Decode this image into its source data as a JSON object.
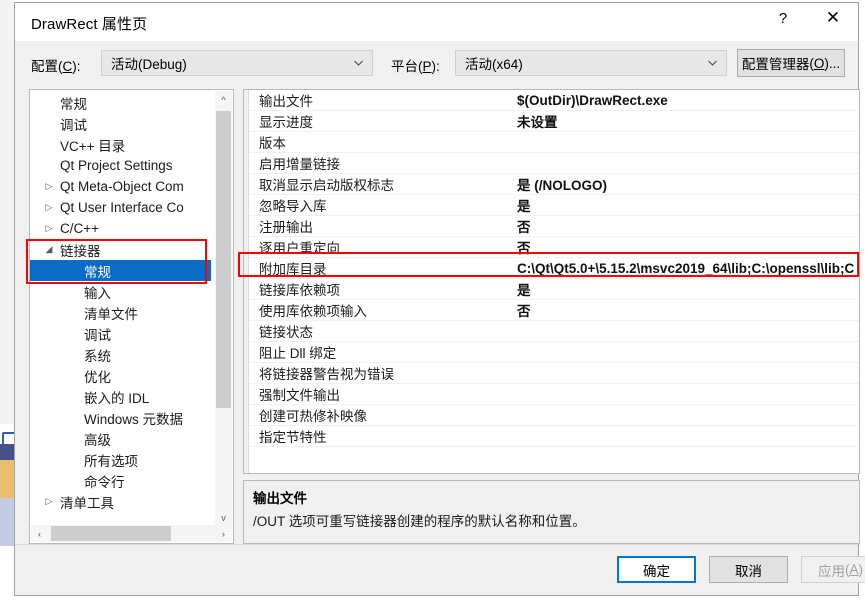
{
  "window": {
    "title": "DrawRect 属性页",
    "help_button": "?",
    "close_button": "✕"
  },
  "config_bar": {
    "config_label": "配置(C):",
    "config_label_plain": "配置",
    "config_label_key": "C",
    "config_value": "活动(Debug)",
    "platform_label": "平台(P):",
    "platform_label_plain": "平台",
    "platform_label_key": "P",
    "platform_value": "活动(x64)",
    "config_manager_button": "配置管理器(O)...",
    "config_manager_plain": "配置管理器",
    "config_manager_key": "O",
    "config_manager_suffix": "..."
  },
  "tree": {
    "items": [
      {
        "label": "常规",
        "indent": 0,
        "arrow": "",
        "selected": false
      },
      {
        "label": "调试",
        "indent": 0,
        "arrow": "",
        "selected": false
      },
      {
        "label": "VC++ 目录",
        "indent": 0,
        "arrow": "",
        "selected": false
      },
      {
        "label": "Qt Project Settings",
        "indent": 0,
        "arrow": "",
        "selected": false
      },
      {
        "label": "Qt Meta-Object Com",
        "indent": 0,
        "arrow": "▷",
        "selected": false
      },
      {
        "label": "Qt User Interface Co",
        "indent": 0,
        "arrow": "▷",
        "selected": false
      },
      {
        "label": "C/C++",
        "indent": 0,
        "arrow": "▷",
        "selected": false
      },
      {
        "label": "链接器",
        "indent": 0,
        "arrow": "◢",
        "selected": false
      },
      {
        "label": "常规",
        "indent": 1,
        "arrow": "",
        "selected": true
      },
      {
        "label": "输入",
        "indent": 1,
        "arrow": "",
        "selected": false
      },
      {
        "label": "清单文件",
        "indent": 1,
        "arrow": "",
        "selected": false
      },
      {
        "label": "调试",
        "indent": 1,
        "arrow": "",
        "selected": false
      },
      {
        "label": "系统",
        "indent": 1,
        "arrow": "",
        "selected": false
      },
      {
        "label": "优化",
        "indent": 1,
        "arrow": "",
        "selected": false
      },
      {
        "label": "嵌入的 IDL",
        "indent": 1,
        "arrow": "",
        "selected": false
      },
      {
        "label": "Windows 元数据",
        "indent": 1,
        "arrow": "",
        "selected": false
      },
      {
        "label": "高级",
        "indent": 1,
        "arrow": "",
        "selected": false
      },
      {
        "label": "所有选项",
        "indent": 1,
        "arrow": "",
        "selected": false
      },
      {
        "label": "命令行",
        "indent": 1,
        "arrow": "",
        "selected": false
      },
      {
        "label": "清单工具",
        "indent": 0,
        "arrow": "▷",
        "selected": false
      }
    ],
    "scroll_up_icon": "^",
    "scroll_down_icon": "v",
    "scroll_left_icon": "‹",
    "scroll_right_icon": "›"
  },
  "properties": {
    "rows": [
      {
        "name": "输出文件",
        "value": "$(OutDir)\\DrawRect.exe"
      },
      {
        "name": "显示进度",
        "value": "未设置"
      },
      {
        "name": "版本",
        "value": ""
      },
      {
        "name": "启用增量链接",
        "value": ""
      },
      {
        "name": "取消显示启动版权标志",
        "value": "是 (/NOLOGO)"
      },
      {
        "name": "忽略导入库",
        "value": "是"
      },
      {
        "name": "注册输出",
        "value": "否"
      },
      {
        "name": "逐用户重定向",
        "value": "否"
      },
      {
        "name": "附加库目录",
        "value": "C:\\Qt\\Qt5.0+\\5.15.2\\msvc2019_64\\lib;C:\\openssl\\lib;C"
      },
      {
        "name": "链接库依赖项",
        "value": "是"
      },
      {
        "name": "使用库依赖项输入",
        "value": "否"
      },
      {
        "name": "链接状态",
        "value": ""
      },
      {
        "name": "阻止 Dll 绑定",
        "value": ""
      },
      {
        "name": "将链接器警告视为错误",
        "value": ""
      },
      {
        "name": "强制文件输出",
        "value": ""
      },
      {
        "name": "创建可热修补映像",
        "value": ""
      },
      {
        "name": "指定节特性",
        "value": ""
      }
    ]
  },
  "description": {
    "title": "输出文件",
    "body": "/OUT 选项可重写链接器创建的程序的默认名称和位置。"
  },
  "footer": {
    "ok": "确定",
    "cancel": "取消",
    "apply_plain": "应用",
    "apply_key": "A"
  },
  "annotations": {
    "highlight_color": "#fa0000",
    "selection_color": "#0a6cc4"
  }
}
